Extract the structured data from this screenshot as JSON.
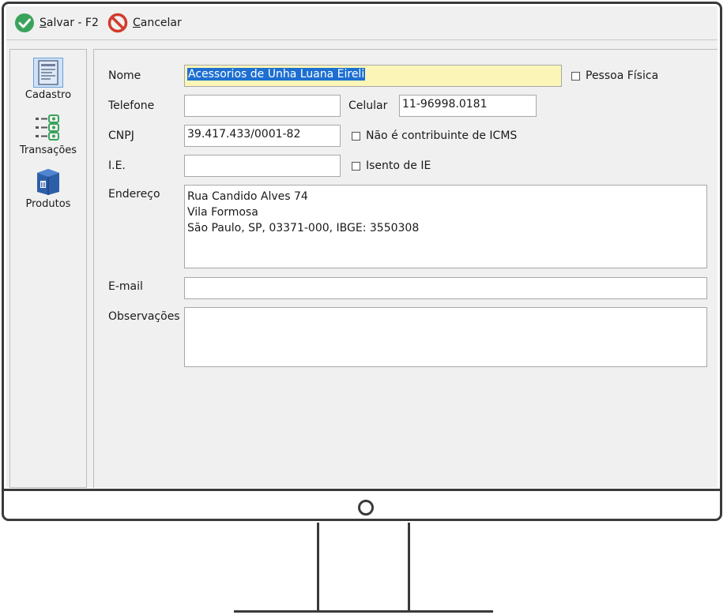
{
  "toolbar": {
    "save": {
      "hotkey": "S",
      "rest": "alvar - F2",
      "icon": "check-circle-icon",
      "color": "#3aa35b"
    },
    "cancel": {
      "hotkey": "C",
      "rest": "ancelar",
      "icon": "cancel-icon",
      "color": "#d23a2a"
    }
  },
  "sidebar": {
    "items": [
      {
        "label": "Cadastro",
        "icon": "form-icon"
      },
      {
        "label": "Transações",
        "icon": "list-icon"
      },
      {
        "label": "Produtos",
        "icon": "box-icon"
      }
    ]
  },
  "form": {
    "nome": {
      "label": "Nome",
      "value": "Acessorios de Unha Luana Eireli"
    },
    "pessoa_fisica": {
      "label": "Pessoa Física",
      "checked": false
    },
    "telefone": {
      "label": "Telefone",
      "value": ""
    },
    "celular": {
      "label": "Celular",
      "value": "11-96998.0181"
    },
    "cnpj": {
      "label": "CNPJ",
      "value": "39.417.433/0001-82"
    },
    "nao_contribuinte": {
      "label": "Não é contribuinte de ICMS",
      "checked": false
    },
    "ie": {
      "label": "I.E.",
      "value": ""
    },
    "isento_ie": {
      "label": "Isento de IE",
      "checked": false
    },
    "endereco": {
      "label": "Endereço",
      "value": "Rua Candido Alves 74\nVila Formosa\nSão Paulo, SP, 03371-000, IBGE: 3550308"
    },
    "email": {
      "label": "E-mail",
      "value": ""
    },
    "observacoes": {
      "label": "Observações",
      "value": ""
    }
  }
}
